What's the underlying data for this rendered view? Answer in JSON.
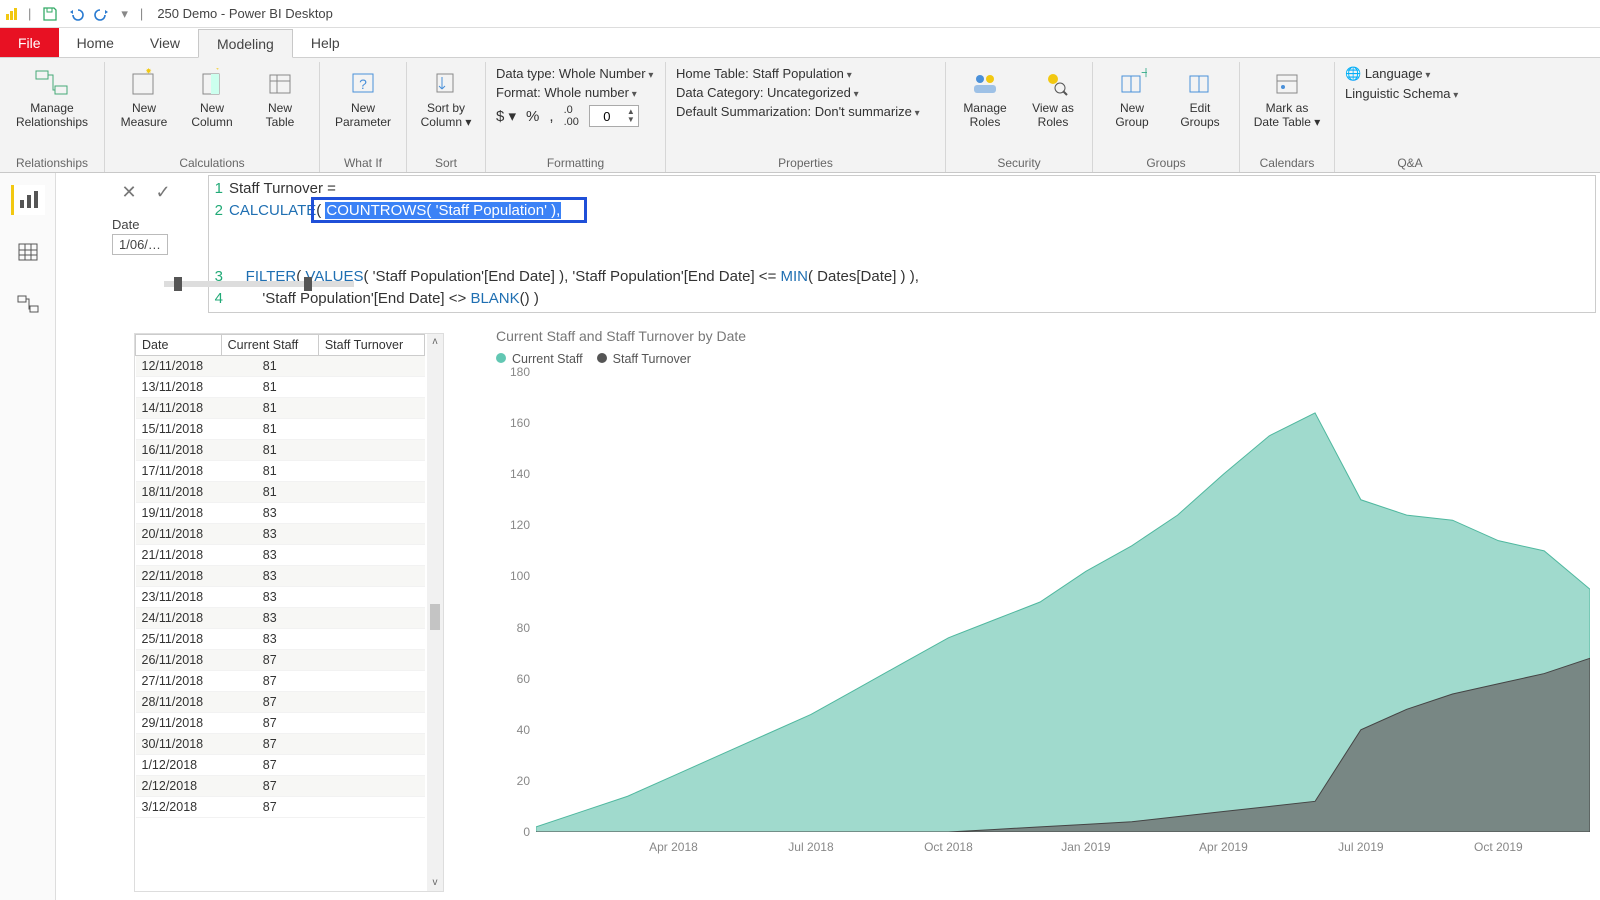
{
  "titlebar": {
    "title": "250 Demo - Power BI Desktop"
  },
  "menu": {
    "file": "File",
    "home": "Home",
    "view": "View",
    "modeling": "Modeling",
    "help": "Help"
  },
  "ribbon": {
    "relationships": {
      "manage": "Manage\nRelationships",
      "group": "Relationships"
    },
    "calculations": {
      "newMeasure": "New\nMeasure",
      "newColumn": "New\nColumn",
      "newTable": "New\nTable",
      "group": "Calculations"
    },
    "whatif": {
      "newParam": "New\nParameter",
      "group": "What If"
    },
    "sort": {
      "sortBy": "Sort by\nColumn ▾",
      "group": "Sort"
    },
    "formatting": {
      "dataType": "Data type: Whole Number",
      "format": "Format: Whole number",
      "decimals": "0",
      "group": "Formatting"
    },
    "properties": {
      "homeTable": "Home Table: Staff Population",
      "dataCategory": "Data Category: Uncategorized",
      "summarization": "Default Summarization: Don't summarize",
      "group": "Properties"
    },
    "security": {
      "manageRoles": "Manage\nRoles",
      "viewAs": "View as\nRoles",
      "group": "Security"
    },
    "groups": {
      "newGroup": "New\nGroup",
      "editGroups": "Edit\nGroups",
      "group": "Groups"
    },
    "calendars": {
      "markAs": "Mark as\nDate Table ▾",
      "group": "Calendars"
    },
    "qa": {
      "language": "Language",
      "schema": "Linguistic Schema",
      "group": "Q&A"
    }
  },
  "formula": {
    "line1": "Staff Turnover =",
    "calc": "CALCULATE",
    "countrows": "COUNTROWS( 'Staff Population' ),",
    "filter": "FILTER",
    "values": "VALUES",
    "filterTail": "( 'Staff Population'[End Date] ), 'Staff Population'[End Date] <= ",
    "min": "MIN",
    "minTail": "( Dates[Date] ) ),",
    "line4a": "'Staff Population'[End Date] <> ",
    "blank": "BLANK",
    "line4b": "() )",
    "dateLabel": "Date",
    "dateVal": "1/06/…"
  },
  "table": {
    "headers": [
      "Date",
      "Current Staff",
      "Staff Turnover"
    ],
    "rows": [
      [
        "12/11/2018",
        "81",
        ""
      ],
      [
        "13/11/2018",
        "81",
        ""
      ],
      [
        "14/11/2018",
        "81",
        ""
      ],
      [
        "15/11/2018",
        "81",
        ""
      ],
      [
        "16/11/2018",
        "81",
        ""
      ],
      [
        "17/11/2018",
        "81",
        ""
      ],
      [
        "18/11/2018",
        "81",
        ""
      ],
      [
        "19/11/2018",
        "83",
        ""
      ],
      [
        "20/11/2018",
        "83",
        ""
      ],
      [
        "21/11/2018",
        "83",
        ""
      ],
      [
        "22/11/2018",
        "83",
        ""
      ],
      [
        "23/11/2018",
        "83",
        ""
      ],
      [
        "24/11/2018",
        "83",
        ""
      ],
      [
        "25/11/2018",
        "83",
        ""
      ],
      [
        "26/11/2018",
        "87",
        ""
      ],
      [
        "27/11/2018",
        "87",
        ""
      ],
      [
        "28/11/2018",
        "87",
        ""
      ],
      [
        "29/11/2018",
        "87",
        ""
      ],
      [
        "30/11/2018",
        "87",
        ""
      ],
      [
        "1/12/2018",
        "87",
        ""
      ],
      [
        "2/12/2018",
        "87",
        ""
      ],
      [
        "3/12/2018",
        "87",
        ""
      ]
    ]
  },
  "chart": {
    "title": "Current Staff and Staff Turnover by Date",
    "legend": [
      "Current Staff",
      "Staff Turnover"
    ],
    "yTicks": [
      0,
      20,
      40,
      60,
      80,
      100,
      120,
      140,
      160,
      180
    ],
    "xTicks": [
      "Apr 2018",
      "Jul 2018",
      "Oct 2018",
      "Jan 2019",
      "Apr 2019",
      "Jul 2019",
      "Oct 2019"
    ]
  },
  "chart_data": {
    "type": "area",
    "title": "Current Staff and Staff Turnover by Date",
    "xlabel": "",
    "ylabel": "",
    "ylim": [
      0,
      180
    ],
    "x": [
      "Jan 2018",
      "Feb 2018",
      "Mar 2018",
      "Apr 2018",
      "May 2018",
      "Jun 2018",
      "Jul 2018",
      "Aug 2018",
      "Sep 2018",
      "Oct 2018",
      "Nov 2018",
      "Dec 2018",
      "Jan 2019",
      "Feb 2019",
      "Mar 2019",
      "Apr 2019",
      "May 2019",
      "Jun 2019",
      "Jul 2019",
      "Aug 2019",
      "Sep 2019",
      "Oct 2019",
      "Nov 2019",
      "Dec 2019"
    ],
    "series": [
      {
        "name": "Current Staff",
        "values": [
          2,
          8,
          14,
          22,
          30,
          38,
          46,
          56,
          66,
          76,
          83,
          90,
          102,
          112,
          124,
          140,
          155,
          164,
          130,
          124,
          122,
          114,
          110,
          95
        ]
      },
      {
        "name": "Staff Turnover",
        "values": [
          0,
          0,
          0,
          0,
          0,
          0,
          0,
          0,
          0,
          0,
          1,
          2,
          3,
          4,
          6,
          8,
          10,
          12,
          40,
          48,
          54,
          58,
          62,
          68
        ]
      }
    ]
  }
}
